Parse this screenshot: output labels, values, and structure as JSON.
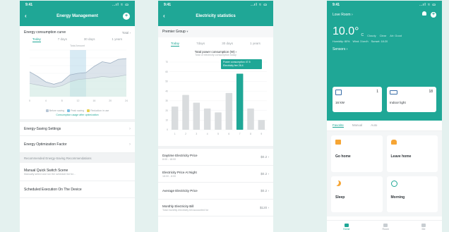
{
  "phone1": {
    "status": {
      "time": "9:41",
      "icons": "..ıl ≈ ▭"
    },
    "title": "Energy Management",
    "card_title": "Energy consumption curve",
    "card_action": "Total ›",
    "tabs": [
      "Today",
      "7 days",
      "30 days",
      "1 years"
    ],
    "chart_top_label": "Total  Amount",
    "legend": [
      "Before saving",
      "Peak saving",
      "Reduction in use"
    ],
    "legend_colors": [
      "#b7c6d6",
      "#7bbde3",
      "#e8d04f"
    ],
    "chart_note": "Consumption usage after optimization",
    "list": [
      "Energy-Saving Settings",
      "Energy Optimization Factor"
    ],
    "section": "Recommended Energy-Saving Recommendations",
    "list2": [
      {
        "label": "Manual Quick Switch Scene",
        "sub": "Manually select and run the schedule list for..."
      },
      {
        "label": "Scheduled Execution On The Device",
        "sub": ""
      }
    ],
    "chart_data": {
      "type": "area",
      "x": [
        "0",
        "2",
        "4",
        "6",
        "8",
        "10",
        "12",
        "14",
        "16",
        "18",
        "20",
        "22",
        "24"
      ],
      "series": [
        {
          "name": "Before saving",
          "values": [
            3.2,
            2.6,
            1.9,
            1.6,
            1.9,
            2.8,
            3.0,
            3.1,
            3.9,
            4.5,
            4.3,
            4.8,
            4.9
          ]
        },
        {
          "name": "Peak saving",
          "values": [
            1.7,
            1.5,
            1.3,
            1.2,
            1.4,
            1.9,
            2.2,
            2.3,
            2.4,
            2.6,
            2.5,
            2.6,
            2.8
          ]
        }
      ],
      "highlight_range": [
        10,
        14
      ],
      "colors": {
        "top": "#c5d2de",
        "bottom": "#c8e6df",
        "highlight": "#8ec7e0"
      }
    }
  },
  "phone2": {
    "status": {
      "time": "9:41",
      "icons": "..ıl ≈ ▭"
    },
    "title": "Electricity statistics",
    "selector": "Premier Group",
    "tabs": [
      "Today",
      "7days",
      "30 days",
      "1 years"
    ],
    "chart_title": "Total power consumption (W) ›",
    "chart_subtitle": "Total of electricity consumption today",
    "tooltip": [
      "Power consumption 47.5",
      "Electricity fee 26.4"
    ],
    "prices": [
      {
        "label": "Daytime Electricity Price",
        "sub": "8:00 - 18:00",
        "value": "$0.2 ›"
      },
      {
        "label": "Electricity Price At Night",
        "sub": "18:00 - 8:00",
        "value": "$0.2 ›"
      },
      {
        "label": "Average Electricity Price",
        "sub": "",
        "value": "$0.2 ›"
      },
      {
        "label": "Monthly Electricity Bill",
        "sub": "Total monthly electricity bill accounted for",
        "value": "$120 ›"
      }
    ],
    "chart_data": {
      "type": "bar",
      "categories": [
        "1",
        "2",
        "3",
        "4",
        "5",
        "6",
        "7",
        "8",
        "9"
      ],
      "values": [
        24,
        36,
        28,
        22,
        18,
        38,
        58,
        22,
        10
      ],
      "highlight_index": 6,
      "ylim": [
        0,
        70
      ],
      "colors": {
        "bar": "#d9dcde",
        "highlight": "#1fa796"
      }
    }
  },
  "phone3": {
    "status": {
      "time": "9:41",
      "icons": "..ıl ≈ ▭"
    },
    "home_name": "Love Room ›",
    "temp": "10.0°",
    "temp_unit": "C",
    "weather": [
      "Cloudy",
      "Clear",
      "Air: Good"
    ],
    "weather_details": [
      "Humidity: 80%",
      "Wind: 3 km/h",
      "Sunset: 18:20"
    ],
    "status_label": "Sensors ›",
    "devices": [
      {
        "label": "16 kW",
        "count": "1"
      },
      {
        "label": "Indoor light",
        "count": "18"
      }
    ],
    "tabs": [
      "Favorite",
      "Manual",
      "Auto"
    ],
    "scenes": [
      {
        "label": "Go home",
        "color": "#f6a534"
      },
      {
        "label": "Leave home",
        "color": "#f6a534"
      },
      {
        "label": "Sleep",
        "color": "#f6a534"
      },
      {
        "label": "Morning",
        "color": "#1fa796"
      }
    ],
    "nav": [
      "Home",
      "Room",
      "Me"
    ]
  }
}
